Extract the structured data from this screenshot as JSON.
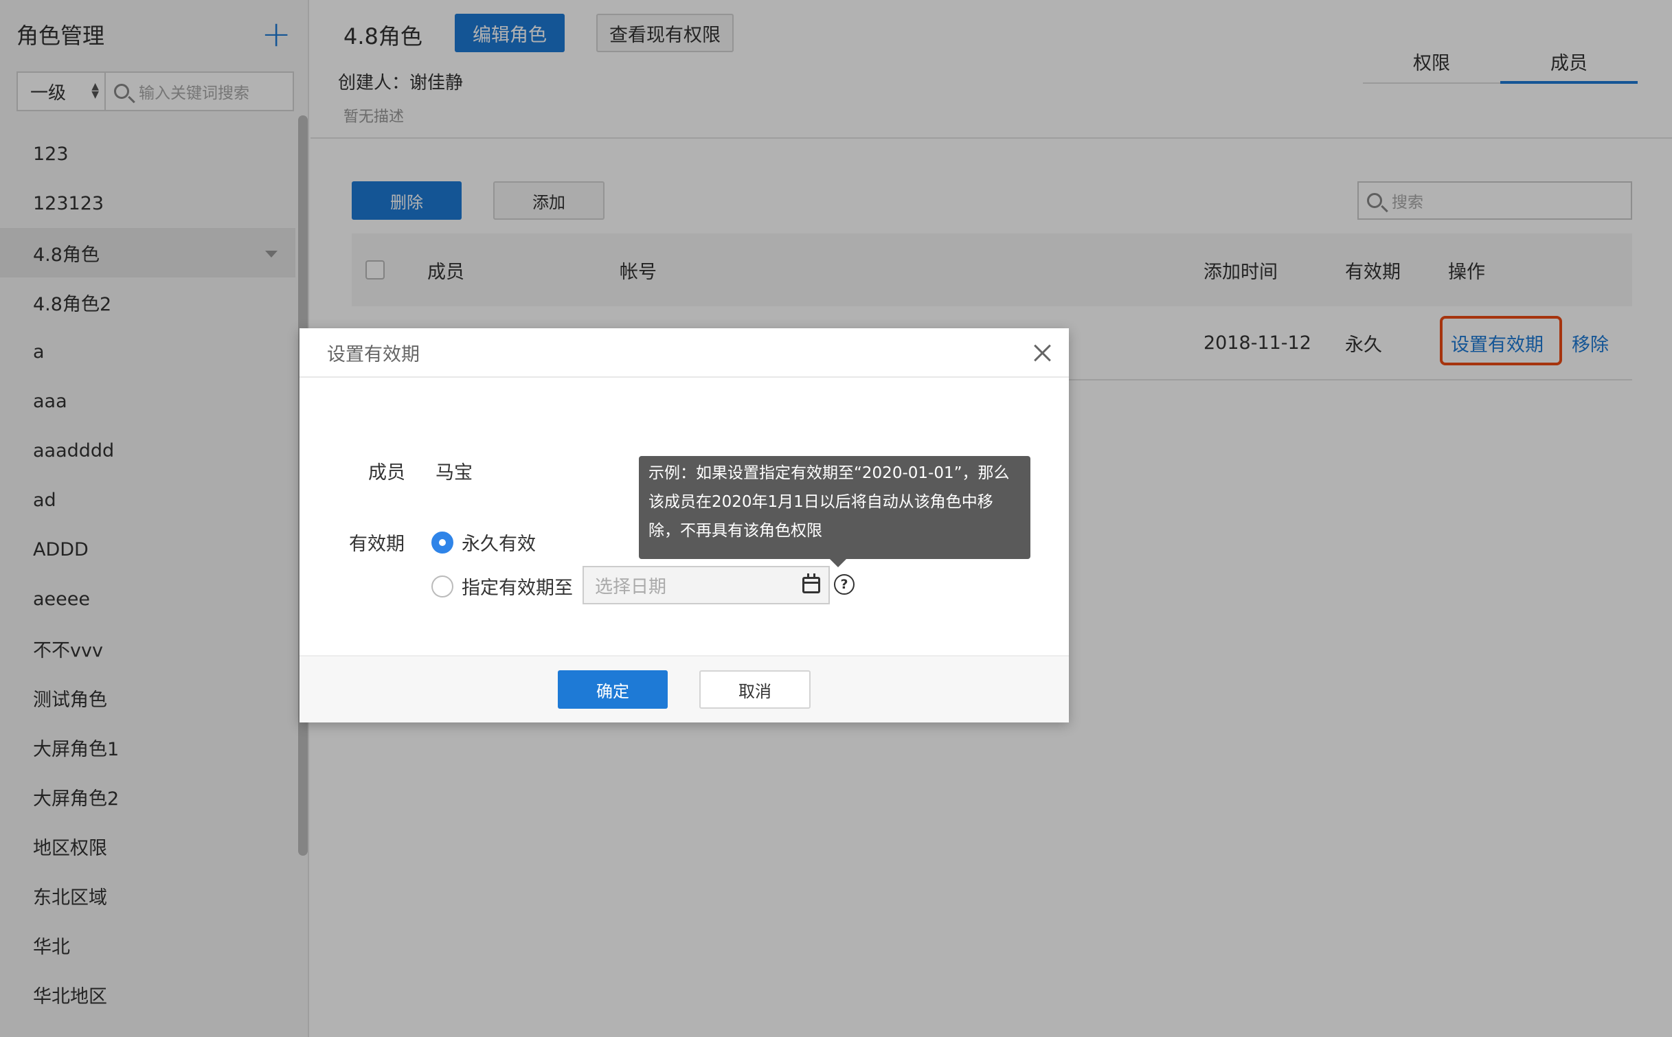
{
  "sidebar": {
    "title": "角色管理",
    "add_icon": "plus-icon",
    "level_select": "一级",
    "search_placeholder": "输入关键词搜索",
    "items": [
      {
        "label": "123"
      },
      {
        "label": "123123"
      },
      {
        "label": "4.8角色",
        "active": true
      },
      {
        "label": "4.8角色2"
      },
      {
        "label": "a"
      },
      {
        "label": "aaa"
      },
      {
        "label": "aaadddd"
      },
      {
        "label": "ad"
      },
      {
        "label": "ADDD"
      },
      {
        "label": "aeeee"
      },
      {
        "label": "不不vvv"
      },
      {
        "label": "测试角色"
      },
      {
        "label": "大屏角色1"
      },
      {
        "label": "大屏角色2"
      },
      {
        "label": "地区权限"
      },
      {
        "label": "东北区域"
      },
      {
        "label": "华北"
      },
      {
        "label": "华北地区"
      }
    ]
  },
  "header": {
    "role_name": "4.8角色",
    "edit_button": "编辑角色",
    "view_perm_button": "查看现有权限",
    "creator": "创建人：谢佳静",
    "description": "暂无描述",
    "tabs": [
      {
        "label": "权限",
        "active": false
      },
      {
        "label": "成员",
        "active": true
      }
    ]
  },
  "members": {
    "delete_button": "删除",
    "add_button": "添加",
    "search_placeholder": "搜索",
    "columns": {
      "member": "成员",
      "account": "帐号",
      "added_time": "添加时间",
      "validity": "有效期",
      "actions": "操作"
    },
    "rows": [
      {
        "added_time": "2018-11-12",
        "validity": "永久",
        "action_set": "设置有效期",
        "action_remove": "移除"
      }
    ]
  },
  "modal": {
    "title": "设置有效期",
    "member_label": "成员",
    "member_value": "马宝",
    "validity_label": "有效期",
    "option_permanent": "永久有效",
    "option_until": "指定有效期至",
    "selected_option": "permanent",
    "date_placeholder": "选择日期",
    "tooltip_lines": [
      "示例：如果设置指定有效期至“2020-01-01”，那么",
      "该成员在2020年1月1日以后将自动从该角色中移",
      "除，不再具有该角色权限"
    ],
    "ok_button": "确定",
    "cancel_button": "取消"
  },
  "colors": {
    "primary": "#1e7ad6",
    "highlight": "#ee4b15",
    "tooltip_bg": "#5a5a5a"
  }
}
